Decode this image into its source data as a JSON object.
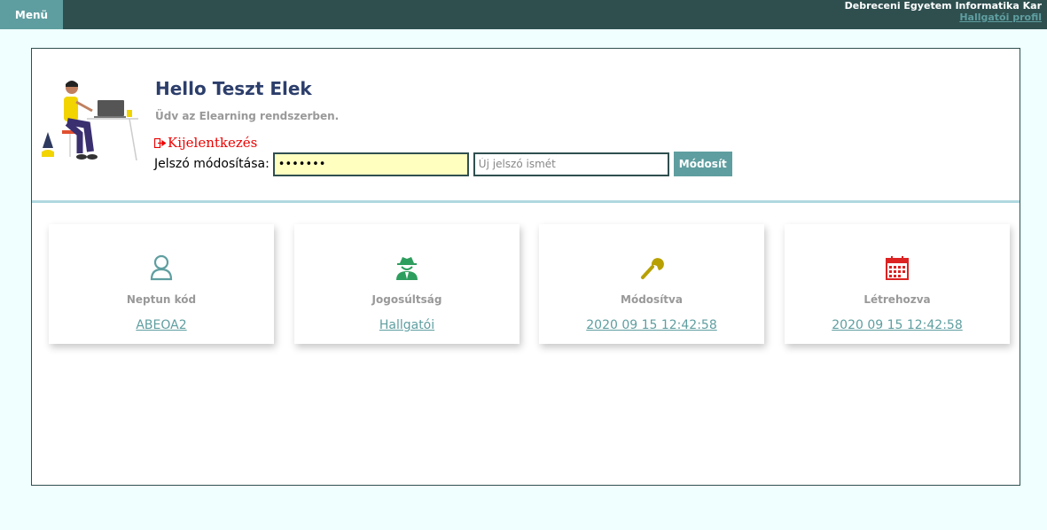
{
  "topbar": {
    "menu_label": "Menü",
    "brand_title": "Debreceni Egyetem Informatika Kar",
    "profile_link": "Hallgatói profil"
  },
  "hero": {
    "greeting": "Hello Teszt Elek",
    "welcome": "Üdv az Elearning rendszerben.",
    "logout_label": "Kijelentkezés",
    "password_label": "Jelszó módosítása:",
    "password_value": "•••••••",
    "password_repeat_placeholder": "Új jelszó ismét",
    "submit_label": "Módosít"
  },
  "cards": [
    {
      "icon": "user-icon",
      "label": "Neptun kód",
      "value": "ABEOA2",
      "color": "#5f9ea0"
    },
    {
      "icon": "spy-icon",
      "label": "Jogosúltság",
      "value": "Hallgatói",
      "color": "#2e9e5e"
    },
    {
      "icon": "wrench-icon",
      "label": "Módosítva",
      "value": "2020 09 15 12:42:58",
      "color": "#b8a000"
    },
    {
      "icon": "calendar-icon",
      "label": "Létrehozva",
      "value": "2020 09 15 12:42:58",
      "color": "#d22"
    }
  ],
  "colors": {
    "topbar": "#2f4f4f",
    "accent": "#5f9ea0",
    "page_bg": "#f0ffff"
  }
}
